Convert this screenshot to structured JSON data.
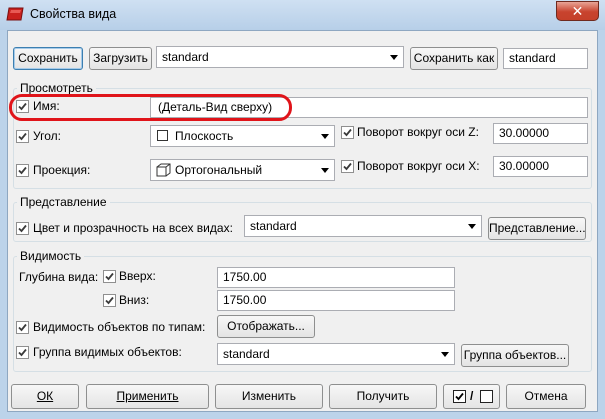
{
  "window": {
    "title": "Свойства вида",
    "close_glyph": "✕"
  },
  "toolbar": {
    "save_label": "Сохранить",
    "load_label": "Загрузить",
    "preset_value": "standard",
    "save_as_label": "Сохранить как",
    "save_as_value": "standard"
  },
  "view": {
    "group_title": "Просмотреть",
    "name_label": "Имя:",
    "name_value": "(Деталь-Вид сверху)",
    "angle_label": "Угол:",
    "angle_value": "Плоскость",
    "rot_z_label": "Поворот вокруг оси Z:",
    "rot_z_value": "30.00000",
    "projection_label": "Проекция:",
    "projection_value": "Ортогональный",
    "rot_x_label": "Поворот вокруг оси X:",
    "rot_x_value": "30.00000"
  },
  "representation": {
    "group_title": "Представление",
    "color_label": "Цвет и прозрачность на всех видах:",
    "color_value": "standard",
    "button_label": "Представление..."
  },
  "visibility": {
    "group_title": "Видимость",
    "depth_label": "Глубина вида:",
    "up_label": "Вверх:",
    "up_value": "1750.00",
    "down_label": "Вниз:",
    "down_value": "1750.00",
    "types_label": "Видимость объектов по типам:",
    "display_button": "Отображать...",
    "group_label": "Группа видимых объектов:",
    "group_value": "standard",
    "group_button": "Группа объектов..."
  },
  "footer": {
    "ok": "ОК",
    "apply": "Применить",
    "modify": "Изменить",
    "get": "Получить",
    "toggle_separator": "/",
    "cancel": "Отмена"
  },
  "colors": {
    "highlight": "#e0141a",
    "title_bar": "#bcd3ea",
    "dialog_bg": "#f0f0f0",
    "close_button": "#c8432e"
  }
}
